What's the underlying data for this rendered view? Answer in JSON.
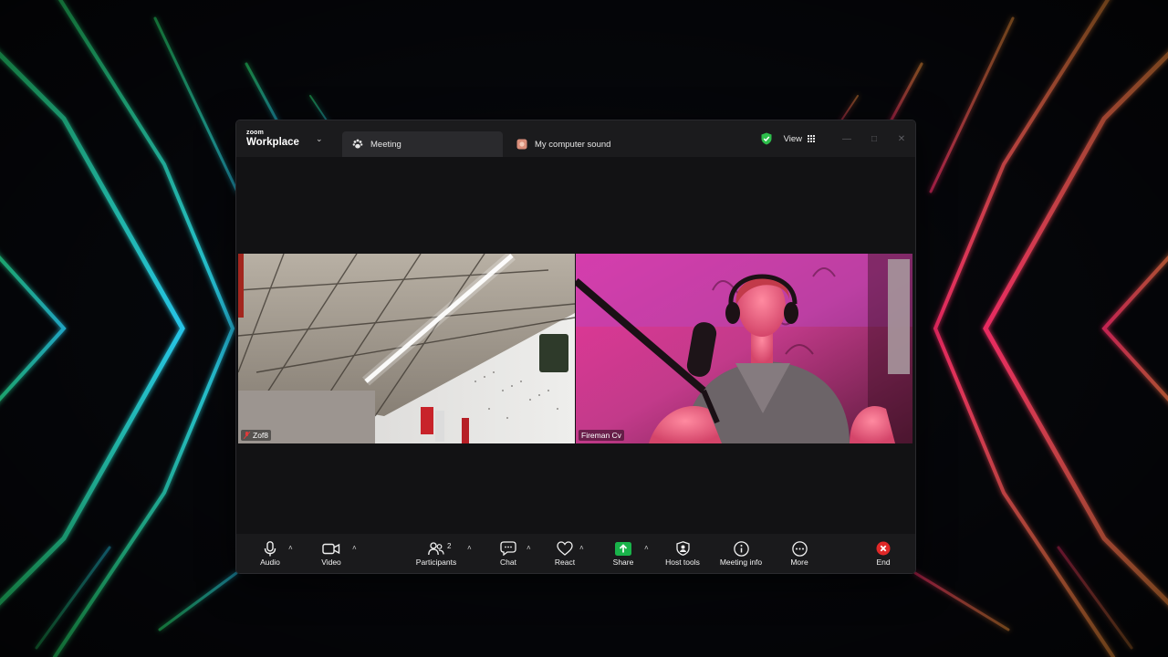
{
  "app": {
    "brand_small": "zoom",
    "brand_big": "Workplace"
  },
  "tabs": [
    {
      "label": "Meeting",
      "icon": "paw-icon"
    },
    {
      "label": "My computer sound",
      "icon": "sound-app-icon"
    }
  ],
  "header": {
    "view_label": "View",
    "security_color": "#2dbe4b"
  },
  "participants": [
    {
      "name": "Zof8"
    },
    {
      "name": "Fireman Cv"
    }
  ],
  "toolbar": {
    "audio": "Audio",
    "video": "Video",
    "participants": "Participants",
    "participants_count": "2",
    "chat": "Chat",
    "react": "React",
    "share": "Share",
    "host_tools": "Host tools",
    "meeting_info": "Meeting info",
    "more": "More",
    "end": "End",
    "share_color": "#19b34a",
    "end_color": "#e02828"
  }
}
